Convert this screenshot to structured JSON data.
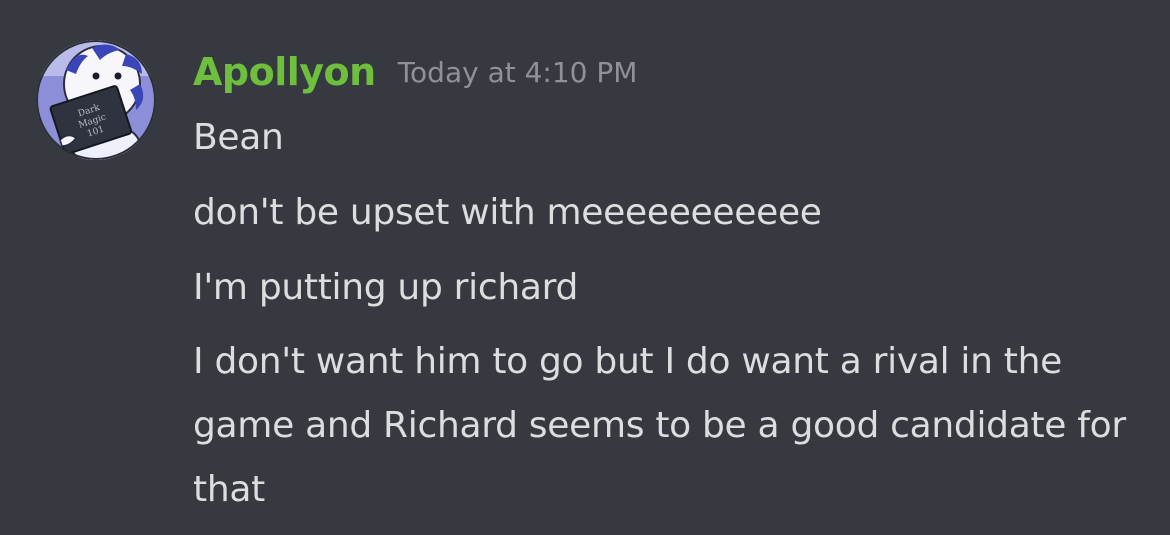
{
  "message": {
    "username": "Apollyon",
    "timestamp": "Today at 4:10 PM",
    "lines": [
      "Bean",
      "don't be upset with meeeeeeeeeee",
      "I'm putting up richard",
      "I don't want him to go but I do want a rival in the game and Richard seems to be a good candidate for that"
    ],
    "username_color": "#6fbf3f",
    "avatar": {
      "icon": "peppermint-butler-avatar-icon",
      "book_text": [
        "Dark",
        "Magic",
        "101"
      ]
    }
  }
}
